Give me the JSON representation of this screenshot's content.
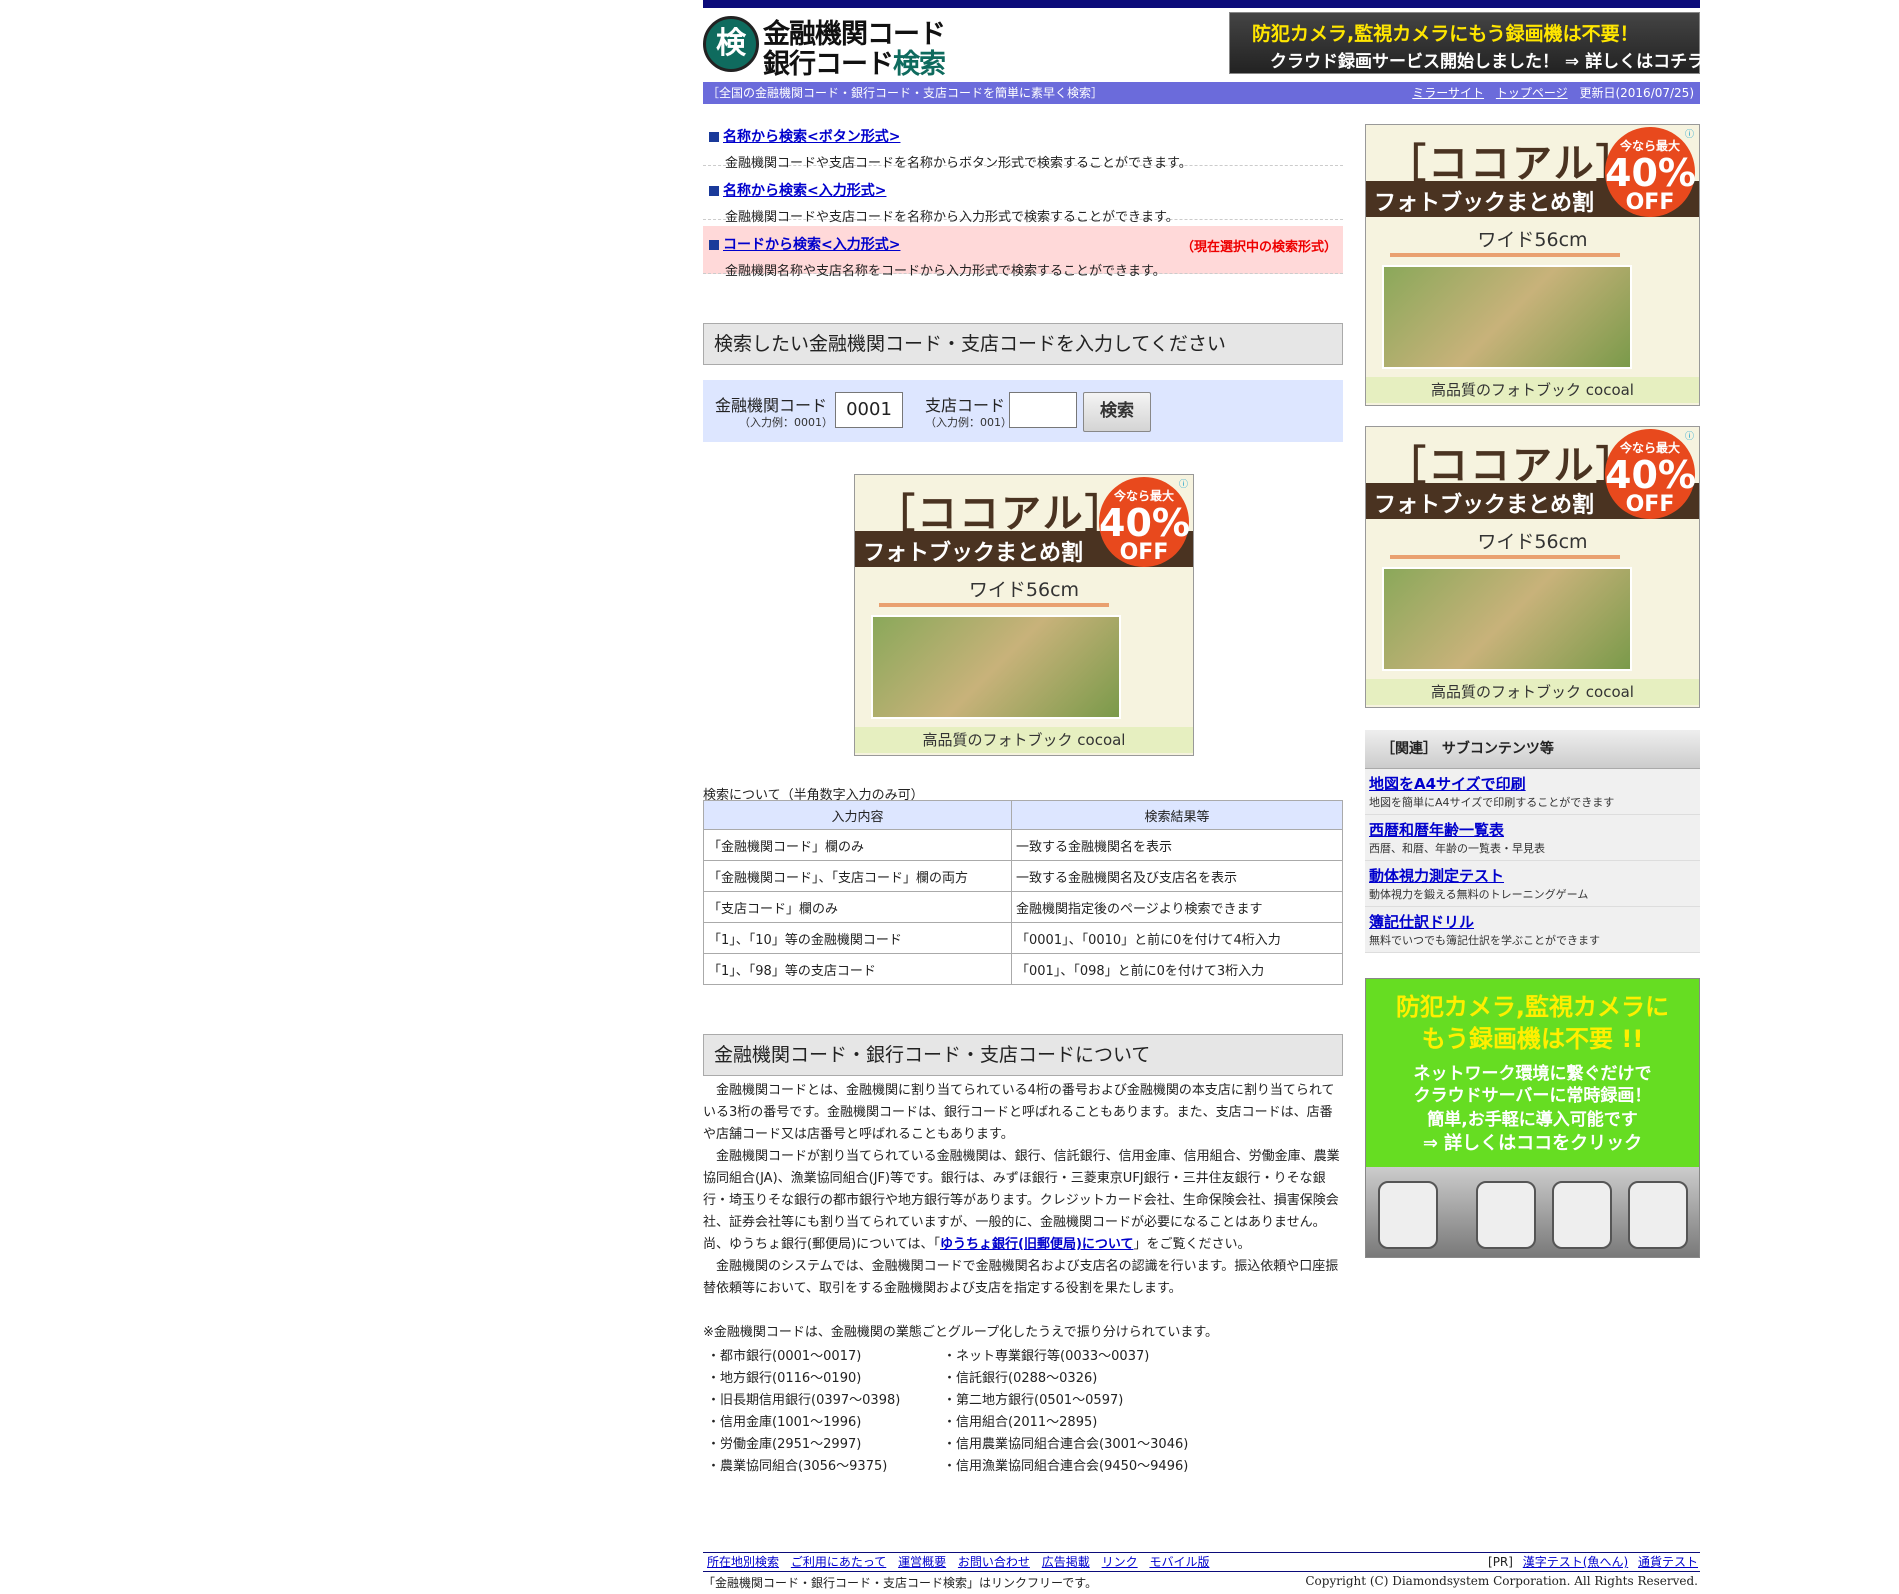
{
  "header": {
    "logo_badge": "検",
    "logo_line1": "金融機関コード",
    "logo_line2a": "銀行コード",
    "logo_line2b": "検索",
    "banner_line1": "防犯カメラ,監視カメラにもう録画機は不要！",
    "banner_line2": "クラウド録画サービス開始しました！ ⇒ 詳しくはコチラ"
  },
  "navbar": {
    "tagline": "［全国の金融機関コード・銀行コード・支店コードを簡単に素早く検索］",
    "links": [
      "ミラーサイト",
      "トップページ"
    ],
    "updated": "更新日(2016/07/25)"
  },
  "menu": [
    {
      "label": "名称から検索<ボタン形式>",
      "desc": "金融機関コードや支店コードを名称からボタン形式で検索することができます。"
    },
    {
      "label": "名称から検索<入力形式>",
      "desc": "金融機関コードや支店コードを名称から入力形式で検索することができます。"
    },
    {
      "label": "コードから検索<入力形式>",
      "desc": "金融機関名称や支店名称をコードから入力形式で検索することができます。",
      "current": "（現在選択中の検索形式）"
    }
  ],
  "search": {
    "title": "検索したい金融機関コード・支店コードを入力してください",
    "bank_label": "金融機関コード",
    "bank_example": "（入力例：0001）",
    "bank_value": "0001",
    "branch_label": "支店コード",
    "branch_example": "（入力例：001）",
    "branch_value": "",
    "button": "検索"
  },
  "ad": {
    "title": "［ココアル］",
    "sub": "フォトブックまとめ割",
    "circle_top": "今なら最大",
    "circle_num": "40%",
    "circle_off": "OFF",
    "width": "ワイド56cm",
    "bottom": "高品質のフォトブック cocoal"
  },
  "table": {
    "caption": "検索について（半角数字入力のみ可）",
    "headers": [
      "入力内容",
      "検索結果等"
    ],
    "rows": [
      [
        "「金融機関コード」欄のみ",
        "一致する金融機関名を表示"
      ],
      [
        "「金融機関コード」、「支店コード」欄の両方",
        "一致する金融機関名及び支店名を表示"
      ],
      [
        "「支店コード」欄のみ",
        "金融機関指定後のページより検索できます"
      ],
      [
        "「1」、「10」等の金融機関コード",
        "「0001」、「0010」と前に0を付けて4桁入力"
      ],
      [
        "「1」、「98」等の支店コード",
        "「001」、「098」と前に0を付けて3桁入力"
      ]
    ]
  },
  "about": {
    "title": "金融機関コード・銀行コード・支店コードについて",
    "p1": "金融機関コードとは、金融機関に割り当てられている4桁の番号および金融機関の本支店に割り当てられている3桁の番号です。金融機関コードは、銀行コードと呼ばれることもあります。また、支店コードは、店番や店舗コード又は店番号と呼ばれることもあります。",
    "p2a": "金融機関コードが割り当てられている金融機関は、銀行、信託銀行、信用金庫、信用組合、労働金庫、農業協同組合(JA)、漁業協同組合(JF)等です。銀行は、みずほ銀行・三菱東京UFJ銀行・三井住友銀行・りそな銀行・埼玉りそな銀行の都市銀行や地方銀行等があります。クレジットカード会社、生命保険会社、損害保険会社、証券会社等にも割り当てられていますが、一般的に、金融機関コードが必要になることはありません。尚、ゆうちょ銀行(郵便局)については、「",
    "p2link": "ゆうちょ銀行(旧郵便局)について",
    "p2b": "」をご覧ください。",
    "p3": "金融機関のシステムでは、金融機関コードで金融機関名および支店名の認識を行います。振込依頼や口座振替依頼等において、取引をする金融機関および支店を指定する役割を果たします。",
    "note": "※金融機関コードは、金融機関の業態ごとグループ化したうえで振り分けられています。",
    "groups": [
      "・都市銀行(0001〜0017)",
      "・ネット専業銀行等(0033〜0037)",
      "・地方銀行(0116〜0190)",
      "・信託銀行(0288〜0326)",
      "・旧長期信用銀行(0397〜0398)",
      "・第二地方銀行(0501〜0597)",
      "・信用金庫(1001〜1996)",
      "・信用組合(2011〜2895)",
      "・労働金庫(2951〜2997)",
      "・信用農業協同組合連合会(3001〜3046)",
      "・農業協同組合(3056〜9375)",
      "・信用漁業協同組合連合会(9450〜9496)"
    ]
  },
  "related": {
    "title": "［関連］ サブコンテンツ等",
    "items": [
      {
        "label": "地図をA4サイズで印刷",
        "desc": "地図を簡単にA4サイズで印刷することができます"
      },
      {
        "label": "西暦和暦年齢一覧表",
        "desc": "西暦、和暦、年齢の一覧表・早見表"
      },
      {
        "label": "動体視力測定テスト",
        "desc": "動体視力を鍛える無料のトレーニングゲーム"
      },
      {
        "label": "簿記仕訳ドリル",
        "desc": "無料でいつでも簿記仕訳を学ぶことができます"
      }
    ]
  },
  "cam_ad": {
    "l1": "防犯カメラ,監視カメラに",
    "l2": "もう録画機は不要 !!",
    "l3": "ネットワーク環境に繋ぐだけで",
    "l4": "クラウドサーバーに常時録画！",
    "l5": "簡単,お手軽に導入可能です",
    "l6": "⇒ 詳しくはココをクリック"
  },
  "footer": {
    "links": [
      "所在地別検索",
      "ご利用にあたって",
      "運営概要",
      "お問い合わせ",
      "広告掲載",
      "リンク",
      "モバイル版"
    ],
    "pr": "[PR]",
    "pr_links": [
      "漢字テスト(魚へん)",
      "通貨テスト"
    ],
    "linkfree": "「金融機関コード・銀行コード・支店コード検索」はリンクフリーです。",
    "copyright": "Copyright (C) Diamondsystem Corporation. All Rights Reserved."
  }
}
